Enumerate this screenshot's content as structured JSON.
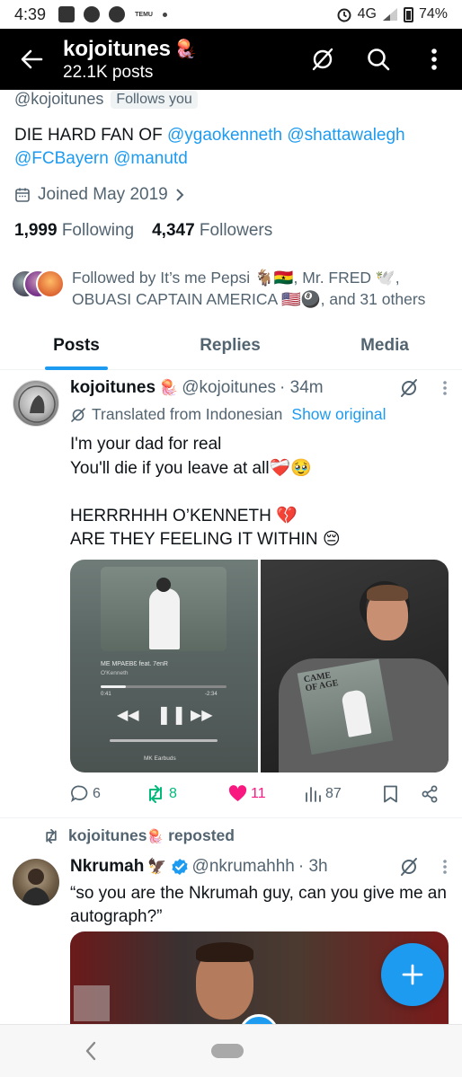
{
  "status_bar": {
    "time": "4:39",
    "temu_label": "TEMU",
    "network": "4G",
    "battery": "74%"
  },
  "header": {
    "name": "kojoitunes",
    "posts_count": "22.1K posts"
  },
  "profile": {
    "handle": "@kojoitunes",
    "follows_you": "Follows you",
    "bio_prefix": "DIE HARD FAN OF",
    "bio_mentions": [
      "@ygaokenneth",
      "@shattawalegh",
      "@FCBayern",
      "@manutd"
    ],
    "joined": "Joined May 2019",
    "following_count": "1,999",
    "following_label": "Following",
    "followers_count": "4,347",
    "followers_label": "Followers",
    "followed_by": "Followed by It’s me Pepsi 🐐🇬🇭, Mr. FRED 🕊️, OBUASI CAPTAIN AMERICA 🇺🇸🎱, and 31 others"
  },
  "tabs": [
    "Posts",
    "Replies",
    "Media"
  ],
  "post": {
    "name": "kojoitunes",
    "handle": "@kojoitunes",
    "time": "· 34m",
    "translated_label": "Translated from Indonesian",
    "show_original": "Show original",
    "text": "I'm your dad for real\nYou'll die if you leave at all❤️‍🩹🥹\n\nHERRRHHH O’KENNETH 💔\nARE THEY FEELING IT WITHIN 😔",
    "media_left": {
      "track": "ME MPAEBƐ feat. 7enR",
      "artist": "O'Kenneth",
      "elapsed": "0:41",
      "remaining": "-2:34",
      "device": "MK Earbuds"
    },
    "media_right": {
      "album_text": "CAME OF AGE"
    },
    "replies": "6",
    "reposts": "8",
    "likes": "11",
    "views": "87"
  },
  "repost_item": {
    "label": "kojoitunes",
    "label_suffix": "reposted",
    "name": "Nkrumah",
    "name_emoji": "🦅",
    "handle": "@nkrumahhh",
    "time": "· 3h",
    "text": "“so you are the Nkrumah guy, can you give me an autograph?”"
  },
  "colors": {
    "accent": "#1d9bf0",
    "like": "#f91880",
    "repost": "#00ba7c",
    "muted": "#536471"
  }
}
